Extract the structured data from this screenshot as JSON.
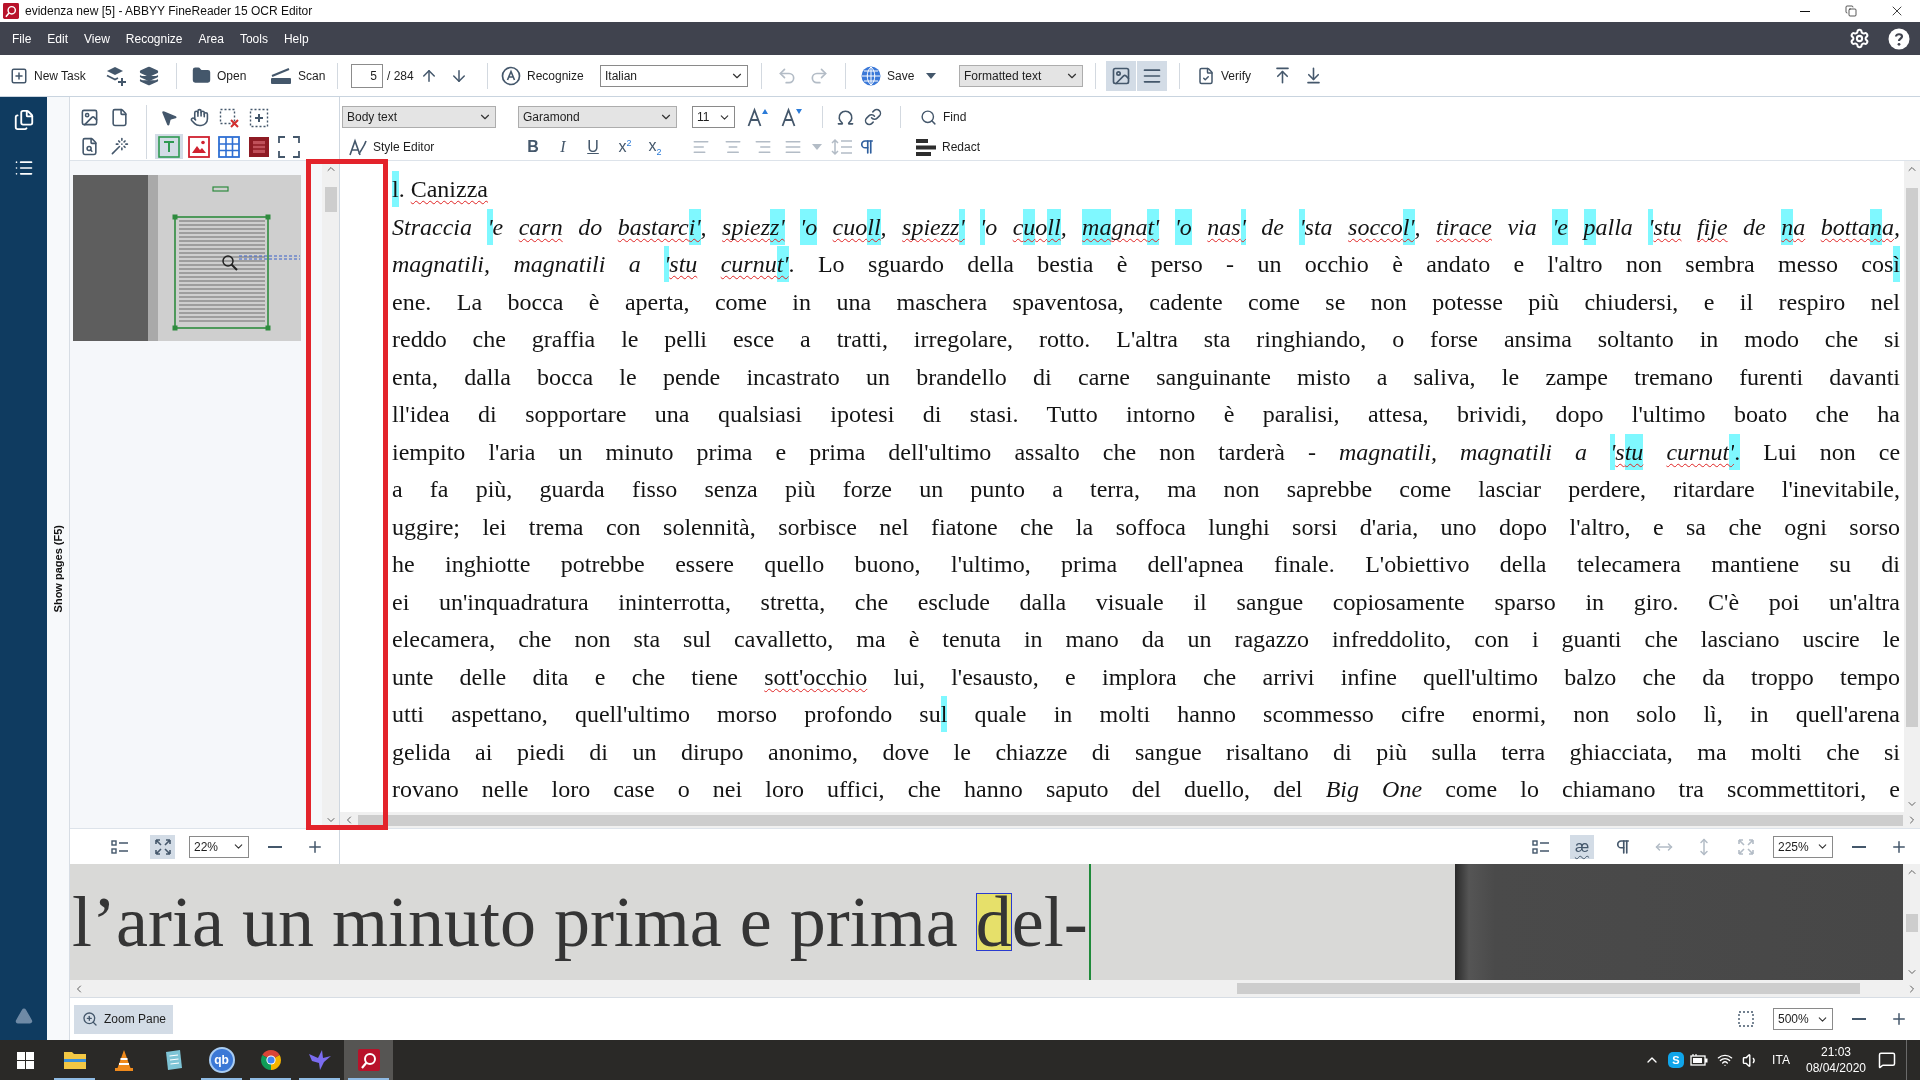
{
  "window": {
    "title": "evidenza new [5] - ABBYY FineReader 15 OCR Editor"
  },
  "menu": {
    "items": [
      "File",
      "Edit",
      "View",
      "Recognize",
      "Area",
      "Tools",
      "Help"
    ]
  },
  "toolbar": {
    "new_task": "New Task",
    "open": "Open",
    "scan": "Scan",
    "page": "5",
    "page_total": "/ 284",
    "recognize": "Recognize",
    "language": "Italian",
    "undo": {
      "disabled": true
    },
    "redo": {
      "disabled": true
    },
    "save": "Save",
    "view_mode": "Formatted text",
    "panes": [
      {
        "kind": "image",
        "selected": true
      },
      {
        "kind": "text",
        "selected": true
      }
    ],
    "verify": "Verify"
  },
  "pages_strip": {
    "label": "Show pages (F5)"
  },
  "image_pane": {
    "area_tools": [
      {
        "kind": "text",
        "selected": true
      },
      {
        "kind": "picture",
        "selected": false
      },
      {
        "kind": "table",
        "selected": false
      },
      {
        "kind": "background",
        "selected": false
      },
      {
        "kind": "region",
        "selected": false
      }
    ],
    "view_tools": [
      {
        "kind": "properties",
        "selected": false
      },
      {
        "kind": "fit-page",
        "selected": true
      }
    ],
    "zoom": "22%"
  },
  "text_pane": {
    "style": "Body text",
    "font": "Garamond",
    "size": "11",
    "style_editor": "Style Editor",
    "find": "Find",
    "redact": "Redact",
    "format_buttons": [
      {
        "kind": "bold",
        "label": "B"
      },
      {
        "kind": "italic",
        "label": "I"
      },
      {
        "kind": "underline",
        "label": "U"
      },
      {
        "kind": "superscript",
        "label": "x$^{2}$"
      },
      {
        "kind": "subscript",
        "label": "x$_{2}$"
      }
    ],
    "paragraph_tools": [
      {
        "kind": "align-left",
        "disabled": true
      },
      {
        "kind": "align-center",
        "disabled": true
      },
      {
        "kind": "align-right",
        "disabled": true
      },
      {
        "kind": "justify",
        "disabled": true
      },
      {
        "kind": "menu",
        "disabled": true
      },
      {
        "kind": "line-spacing",
        "disabled": true
      },
      {
        "kind": "paragraph",
        "disabled": false
      }
    ],
    "lines": [
      {
        "kind": "title",
        "segments": [
          {
            "text": "l",
            "italic": false,
            "flagged": true,
            "misspelled": false
          },
          {
            "text": ".",
            "italic": false,
            "flagged": false,
            "misspelled": false
          },
          {
            "text": " Canizza",
            "italic": false,
            "flagged": false,
            "misspelled": true
          }
        ]
      },
      {
        "kind": "body",
        "segments": [
          {
            "text": "Straccia",
            "italic": true,
            "flagged": false,
            "misspelled": false
          },
          {
            "text": " '",
            "italic": true,
            "flagged": true,
            "misspelled": false
          },
          {
            "text": "e",
            "italic": true,
            "flagged": false,
            "misspelled": false
          },
          {
            "text": " carn",
            "italic": true,
            "flagged": false,
            "misspelled": true
          },
          {
            "text": " do",
            "italic": true,
            "flagged": false,
            "misspelled": false
          },
          {
            "text": " bastarc",
            "italic": true,
            "flagged": false,
            "misspelled": true
          },
          {
            "text": "i'",
            "italic": true,
            "flagged": true,
            "misspelled": true
          },
          {
            "text": ",",
            "italic": true,
            "flagged": false,
            "misspelled": false
          },
          {
            "text": " spiez",
            "italic": true,
            "flagged": false,
            "misspelled": true
          },
          {
            "text": "z'",
            "italic": true,
            "flagged": true,
            "misspelled": true
          },
          {
            "text": " 'o",
            "italic": true,
            "flagged": true,
            "misspelled": false
          },
          {
            "text": " cuo",
            "italic": true,
            "flagged": false,
            "misspelled": true
          },
          {
            "text": "ll",
            "italic": true,
            "flagged": true,
            "misspelled": true
          },
          {
            "text": ",",
            "italic": true,
            "flagged": false,
            "misspelled": false
          },
          {
            "text": " spiezz",
            "italic": true,
            "flagged": false,
            "misspelled": true
          },
          {
            "text": "'",
            "italic": true,
            "flagged": true,
            "misspelled": true
          },
          {
            "text": " '",
            "italic": true,
            "flagged": true,
            "misspelled": false
          },
          {
            "text": "o",
            "italic": true,
            "flagged": false,
            "misspelled": false
          },
          {
            "text": " c",
            "italic": true,
            "flagged": false,
            "misspelled": true
          },
          {
            "text": "u",
            "italic": true,
            "flagged": true,
            "misspelled": true
          },
          {
            "text": "o",
            "italic": true,
            "flagged": false,
            "misspelled": true
          },
          {
            "text": "ll",
            "italic": true,
            "flagged": true,
            "misspelled": true
          },
          {
            "text": ",",
            "italic": true,
            "flagged": false,
            "misspelled": false
          },
          {
            "text": " ma",
            "italic": true,
            "flagged": true,
            "misspelled": true
          },
          {
            "text": "gna",
            "italic": true,
            "flagged": false,
            "misspelled": true
          },
          {
            "text": "t'",
            "italic": true,
            "flagged": true,
            "misspelled": true
          },
          {
            "text": " 'o",
            "italic": true,
            "flagged": true,
            "misspelled": false
          },
          {
            "text": " nas",
            "italic": true,
            "flagged": false,
            "misspelled": true
          },
          {
            "text": "'",
            "italic": true,
            "flagged": true,
            "misspelled": true
          },
          {
            "text": " de",
            "italic": true,
            "flagged": false,
            "misspelled": false
          },
          {
            "text": " '",
            "italic": true,
            "flagged": true,
            "misspelled": false
          },
          {
            "text": "sta",
            "italic": true,
            "flagged": false,
            "misspelled": false
          },
          {
            "text": " socco",
            "italic": true,
            "flagged": false,
            "misspelled": true
          },
          {
            "text": "l'",
            "italic": true,
            "flagged": true,
            "misspelled": true
          },
          {
            "text": ",",
            "italic": true,
            "flagged": false,
            "misspelled": false
          },
          {
            "text": " tirace",
            "italic": true,
            "flagged": false,
            "misspelled": true
          },
          {
            "text": " via",
            "italic": true,
            "flagged": false,
            "misspelled": false
          },
          {
            "text": " 'e",
            "italic": true,
            "flagged": true,
            "misspelled": false
          },
          {
            "text": " p",
            "italic": true,
            "flagged": true,
            "misspelled": false
          },
          {
            "text": "alla",
            "italic": true,
            "flagged": false,
            "misspelled": false
          },
          {
            "text": " '",
            "italic": true,
            "flagged": true,
            "misspelled": false
          },
          {
            "text": "stu",
            "italic": true,
            "flagged": false,
            "misspelled": true
          },
          {
            "text": " fije",
            "italic": true,
            "flagged": false,
            "misspelled": true
          },
          {
            "text": " de",
            "italic": true,
            "flagged": false,
            "misspelled": false
          },
          {
            "text": " n",
            "italic": true,
            "flagged": true,
            "misspelled": true
          },
          {
            "text": "a",
            "italic": true,
            "flagged": false,
            "misspelled": true
          },
          {
            "text": " botta",
            "italic": true,
            "flagged": false,
            "misspelled": true
          },
          {
            "text": "n",
            "italic": true,
            "flagged": true,
            "misspelled": true
          },
          {
            "text": "a",
            "italic": true,
            "flagged": false,
            "misspelled": true
          },
          {
            "text": ",",
            "italic": true,
            "flagged": false,
            "misspelled": false
          }
        ]
      },
      {
        "kind": "body",
        "segments": [
          {
            "text": "magnatili, magnatili a",
            "italic": true,
            "flagged": false,
            "misspelled": false
          },
          {
            "text": " '",
            "italic": true,
            "flagged": true,
            "misspelled": false
          },
          {
            "text": "stu",
            "italic": true,
            "flagged": false,
            "misspelled": true
          },
          {
            "text": " curnu",
            "italic": true,
            "flagged": false,
            "misspelled": true
          },
          {
            "text": "t'",
            "italic": true,
            "flagged": true,
            "misspelled": true
          },
          {
            "text": ". Lo sguardo della bestia è perso - un occhio è andato e l'altro non sembra messo cos",
            "italic": false,
            "flagged": false,
            "misspelled": false
          },
          {
            "text": "ì",
            "italic": false,
            "flagged": true,
            "misspelled": false
          }
        ]
      },
      {
        "kind": "body",
        "segments": [
          {
            "text": "ene. La bocca è aperta, come in una maschera spaventosa, cadente come se non potesse più chiudersi, e il respiro nel",
            "italic": false,
            "flagged": false,
            "misspelled": false
          }
        ]
      },
      {
        "kind": "body",
        "segments": [
          {
            "text": "reddo che graffia le pelli esce a tratti, irregolare, rotto. L'altra sta ringhiando, o forse ansima soltanto in modo che si",
            "italic": false,
            "flagged": false,
            "misspelled": false
          }
        ]
      },
      {
        "kind": "body",
        "segments": [
          {
            "text": "enta, dalla bocca le pende incastrato un brandello di carne sanguinante misto a saliva, le zampe tremano furenti davanti",
            "italic": false,
            "flagged": false,
            "misspelled": false
          }
        ]
      },
      {
        "kind": "body",
        "segments": [
          {
            "text": "ll'idea di sopportare una qualsiasi ipotesi di stasi. Tutto intorno è paralisi, attesa, brividi, dopo l'ultimo boato che ha",
            "italic": false,
            "flagged": false,
            "misspelled": false
          }
        ]
      },
      {
        "kind": "body",
        "segments": [
          {
            "text": "iempito l'aria un minuto prima e prima dell'ultimo assalto che non tarderà -",
            "italic": false,
            "flagged": false,
            "misspelled": false
          },
          {
            "text": " magnatili, magnatili a",
            "italic": true,
            "flagged": false,
            "misspelled": false
          },
          {
            "text": " '",
            "italic": true,
            "flagged": true,
            "misspelled": false
          },
          {
            "text": "s",
            "italic": true,
            "flagged": false,
            "misspelled": true
          },
          {
            "text": "tu",
            "italic": true,
            "flagged": true,
            "misspelled": true
          },
          {
            "text": " curnut",
            "italic": true,
            "flagged": false,
            "misspelled": true
          },
          {
            "text": "'",
            "italic": true,
            "flagged": true,
            "misspelled": true
          },
          {
            "text": ".",
            "italic": false,
            "flagged": true,
            "misspelled": false
          },
          {
            "text": " Lui non ce",
            "italic": false,
            "flagged": false,
            "misspelled": false
          }
        ]
      },
      {
        "kind": "body",
        "segments": [
          {
            "text": "a fa più, guarda fisso senza più forze un punto a terra, ma non saprebbe come lasciar perdere, ritardare l'inevitabile,",
            "italic": false,
            "flagged": false,
            "misspelled": false
          }
        ]
      },
      {
        "kind": "body",
        "segments": [
          {
            "text": "uggire; lei trema con solennità, sorbisce nel fiatone che la soffoca lunghi sorsi d'aria, uno dopo l'altro, e sa che ogni sorso",
            "italic": false,
            "flagged": false,
            "misspelled": false
          }
        ]
      },
      {
        "kind": "body",
        "segments": [
          {
            "text": "he inghiotte potrebbe essere quello buono, l'ultimo, prima dell'apnea finale. L'obiettivo della telecamera mantiene su di",
            "italic": false,
            "flagged": false,
            "misspelled": false
          }
        ]
      },
      {
        "kind": "body",
        "segments": [
          {
            "text": "ei un'inquadratura ininterrotta, stretta, che esclude dalla visuale il sangue copiosamente sparso in giro. C'è poi un'altra",
            "italic": false,
            "flagged": false,
            "misspelled": false
          }
        ]
      },
      {
        "kind": "body",
        "segments": [
          {
            "text": "elecamera, che non sta sul cavalletto, ma è tenuta in mano da un ragazzo infreddolito, con i guanti che lasciano uscire le",
            "italic": false,
            "flagged": false,
            "misspelled": false
          }
        ]
      },
      {
        "kind": "body",
        "segments": [
          {
            "text": "unte delle dita e che tiene",
            "italic": false,
            "flagged": false,
            "misspelled": false
          },
          {
            "text": " sott'occhio",
            "italic": false,
            "flagged": false,
            "misspelled": true
          },
          {
            "text": " lui, l'esausto, e implora che arrivi infine quell'ultimo balzo che da troppo tempo",
            "italic": false,
            "flagged": false,
            "misspelled": false
          }
        ]
      },
      {
        "kind": "body",
        "segments": [
          {
            "text": "utti aspettano, quell'ultimo morso profondo su",
            "italic": false,
            "flagged": false,
            "misspelled": false
          },
          {
            "text": "l",
            "italic": false,
            "flagged": true,
            "misspelled": false
          },
          {
            "text": " quale in molti hanno scommesso cifre enormi, non solo lì, in quell'arena",
            "italic": false,
            "flagged": false,
            "misspelled": false
          }
        ]
      },
      {
        "kind": "body",
        "segments": [
          {
            "text": "gelida ai piedi di un dirupo anonimo, dove le chiazze di sangue risaltano di più sulla terra ghiacciata, ma molti che si",
            "italic": false,
            "flagged": false,
            "misspelled": false
          }
        ]
      },
      {
        "kind": "body",
        "segments": [
          {
            "text": "rovano nelle loro case o nei loro uffici, che hanno saputo del duello, del",
            "italic": false,
            "flagged": false,
            "misspelled": false
          },
          {
            "text": " Big One",
            "italic": true,
            "flagged": false,
            "misspelled": false
          },
          {
            "text": " come lo chiamano tra scommettitori, e",
            "italic": false,
            "flagged": false,
            "misspelled": false
          }
        ]
      }
    ],
    "view_tools": [
      {
        "kind": "properties",
        "selected": false,
        "disabled": false
      },
      {
        "kind": "uncertain",
        "label": "æ",
        "selected": true,
        "disabled": false
      },
      {
        "kind": "paragraph",
        "selected": false,
        "disabled": false
      },
      {
        "kind": "fit-width",
        "selected": false,
        "disabled": true
      },
      {
        "kind": "fit-height",
        "selected": false,
        "disabled": true
      },
      {
        "kind": "fit-page",
        "selected": false,
        "disabled": true
      }
    ],
    "zoom": "225%"
  },
  "zoom_pane": {
    "segments": [
      {
        "text": "l’aria un minuto prima e prima ",
        "current": false
      },
      {
        "text": "d",
        "current": true
      },
      {
        "text": "el-",
        "current": false
      }
    ],
    "button": "Zoom Pane",
    "zoom": "500%"
  },
  "taskbar": {
    "apps": [
      {
        "kind": "folder",
        "running": true,
        "selected": false
      },
      {
        "kind": "cone",
        "running": false,
        "selected": false
      },
      {
        "kind": "notepad",
        "running": false,
        "selected": false
      },
      {
        "kind": "circle-text",
        "label": "qb",
        "running": true,
        "selected": false
      },
      {
        "kind": "ring",
        "running": true,
        "selected": false
      },
      {
        "kind": "bird",
        "running": true,
        "selected": false
      },
      {
        "kind": "logo",
        "running": true,
        "selected": true
      }
    ],
    "tray": {
      "icons": [
        {
          "kind": "chevron"
        },
        {
          "kind": "badge",
          "label": "S"
        },
        {
          "kind": "battery"
        },
        {
          "kind": "wifi"
        },
        {
          "kind": "volume"
        }
      ],
      "language": "ITA",
      "time": "21:03",
      "date": "08/04/2020"
    }
  }
}
